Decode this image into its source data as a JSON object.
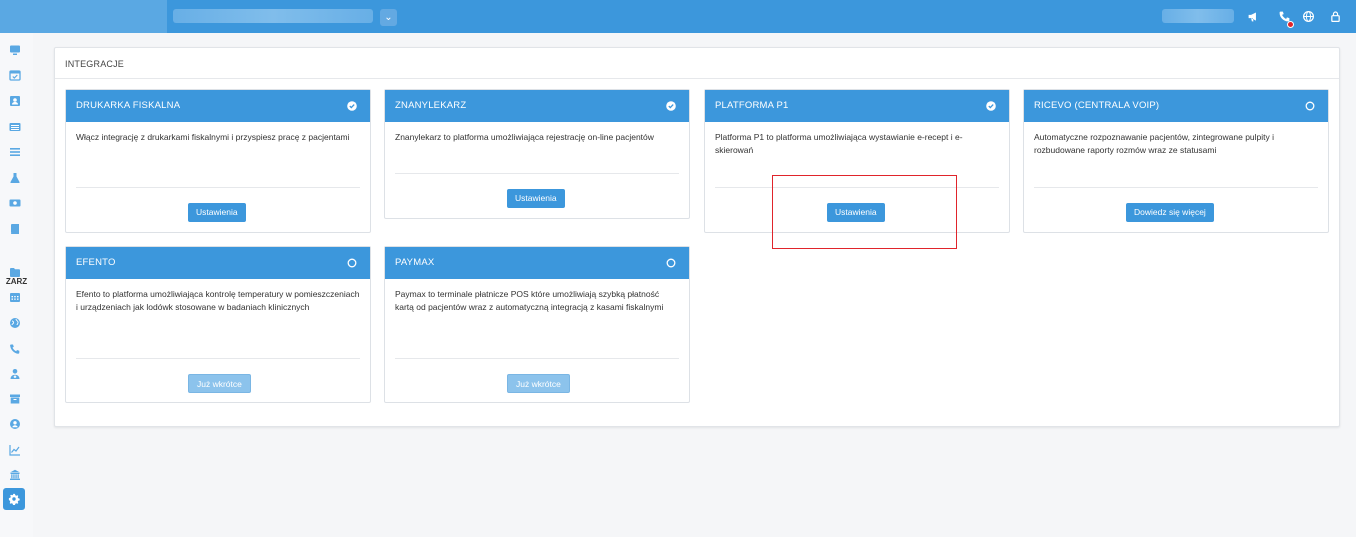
{
  "topbar": {
    "icons": [
      "megaphone-icon",
      "phone-icon",
      "globe-icon",
      "lock-icon"
    ],
    "toggle_glyph": "⌄"
  },
  "sidebar": {
    "section_label": "ZARZ",
    "icons": [
      "monitor-icon",
      "calendar-check-icon",
      "contact-card-icon",
      "list-card-icon",
      "menu-lines-icon",
      "flask-icon",
      "money-icon",
      "book-icon",
      "folder-icon",
      "calendar-grid-icon",
      "globe-icon",
      "phone-icon",
      "doctor-icon",
      "archive-icon",
      "user-circle-icon",
      "chart-line-icon",
      "bank-icon",
      "settings-gear-icon"
    ],
    "active": "settings-gear-icon"
  },
  "panel": {
    "title": "INTEGRACJE"
  },
  "cards": [
    {
      "title": "DRUKARKA FISKALNA",
      "status": "enabled",
      "description": "Włącz integrację z drukarkami fiskalnymi i przyspiesz pracę z pacjentami",
      "button_label": "Ustawienia"
    },
    {
      "title": "ZNANYLEKARZ",
      "status": "enabled",
      "description": "Znanylekarz to platforma umożliwiająca rejestrację on-line pacjentów",
      "button_label": "Ustawienia"
    },
    {
      "title": "PLATFORMA P1",
      "status": "enabled",
      "description": "Platforma P1 to platforma umożliwiająca wystawianie e-recept i e-skierowań",
      "button_label": "Ustawienia"
    },
    {
      "title": "RICEVO (CENTRALA VOIP)",
      "status": "disabled",
      "description": "Automatyczne rozpoznawanie pacjentów, zintegrowane pulpity i rozbudowane raporty rozmów wraz ze statusami",
      "button_label": "Dowiedz się więcej"
    },
    {
      "title": "EFENTO",
      "status": "disabled",
      "description": "Efento to platforma umożliwiająca kontrolę temperatury w pomieszczeniach i urządzeniach jak lodówk stosowane w badaniach klinicznych",
      "button_label": "Już wkrótce"
    },
    {
      "title": "PAYMAX",
      "status": "disabled",
      "description": "Paymax to terminale płatnicze POS które umożliwiają szybką płatność kartą od pacjentów wraz z automatyczną integracją z kasami fiskalnymi",
      "button_label": "Już wkrótce"
    }
  ],
  "colors": {
    "primary": "#3c97dc",
    "highlight": "#e0242b",
    "button_soon": "#8cc3ec"
  }
}
